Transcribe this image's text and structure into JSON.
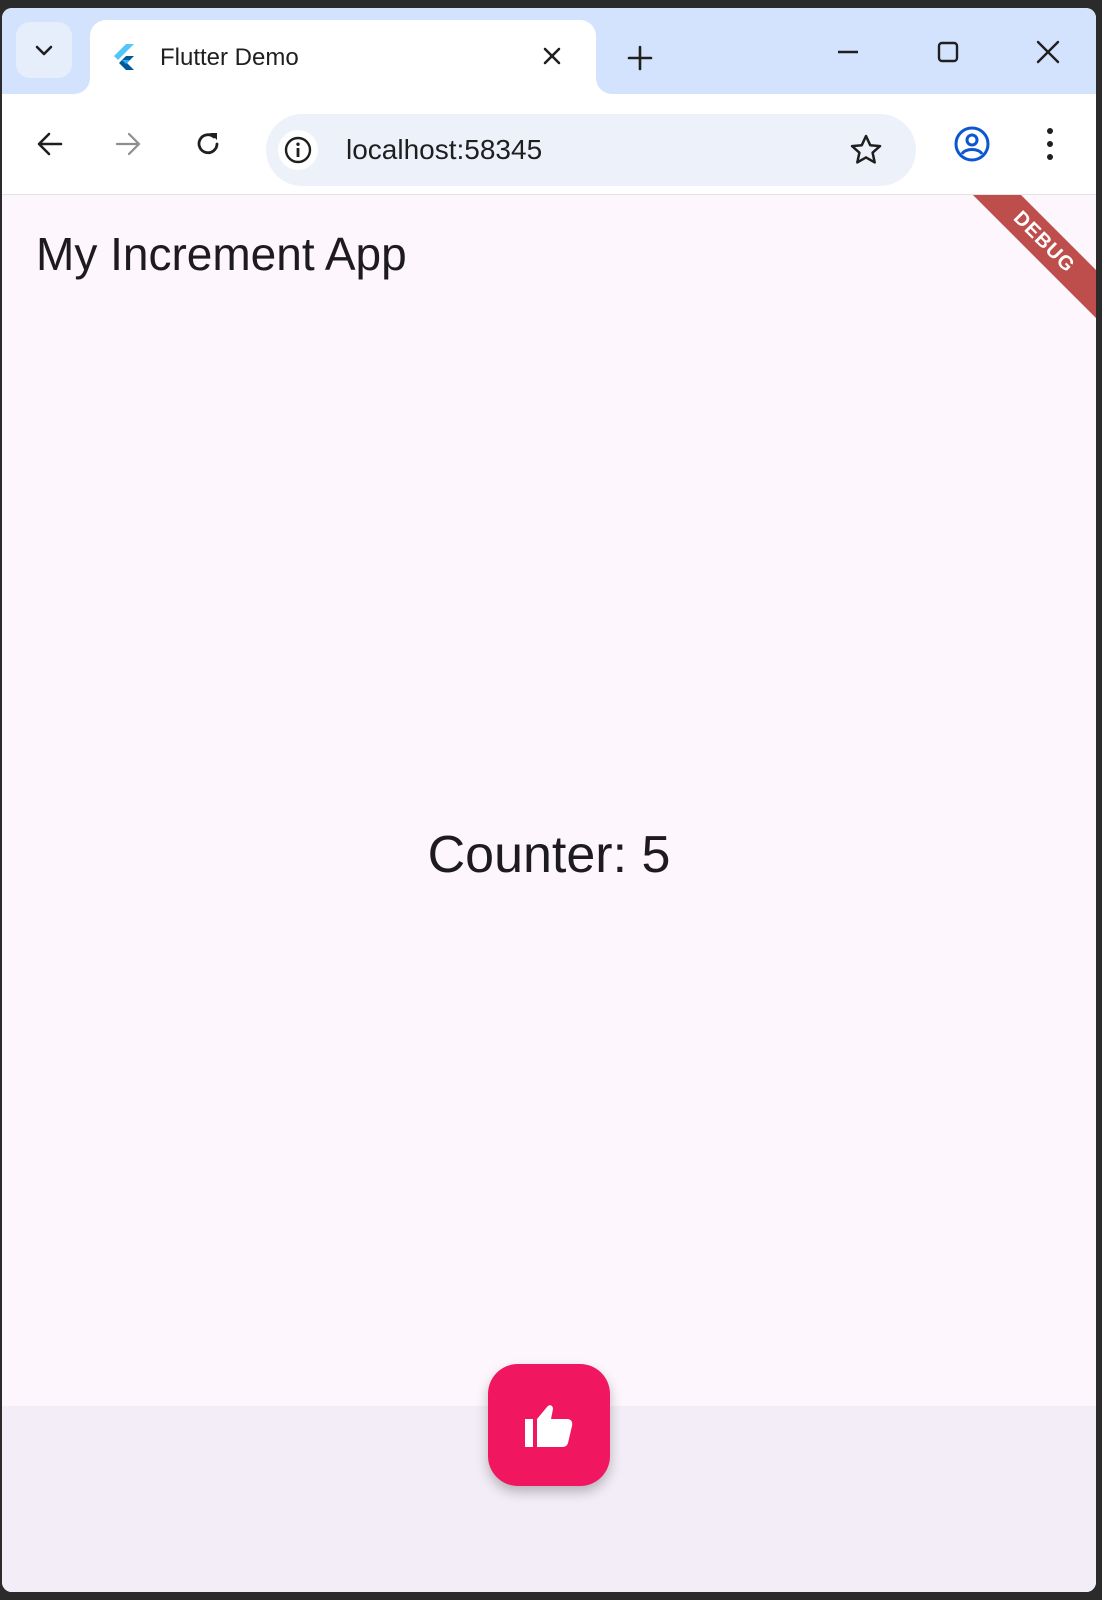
{
  "browser": {
    "tab": {
      "title": "Flutter Demo"
    },
    "address_bar": {
      "url": "localhost:58345"
    },
    "icons": {
      "tab_search": "chevron-down-icon",
      "favicon": "flutter-logo-icon",
      "tab_close": "close-icon",
      "new_tab": "plus-icon",
      "minimize": "minimize-icon",
      "maximize": "maximize-icon",
      "window_close": "close-icon",
      "back": "arrow-left-icon",
      "forward": "arrow-right-icon",
      "reload": "reload-icon",
      "site_info": "info-icon",
      "bookmark": "star-icon",
      "profile": "profile-icon",
      "menu": "more-vert-icon"
    }
  },
  "app": {
    "title": "My Increment App",
    "counter_text": "Counter: 5",
    "debug_banner": "DEBUG",
    "fab_icon": "thumb-up-icon"
  },
  "colors": {
    "fab": "#f0165f",
    "page_background": "#fdf7fd",
    "bottom_bar": "#f3edf7",
    "debug_banner": "#b3312e",
    "tabstrip": "#d3e3fd",
    "profile_accent": "#0b57d0"
  }
}
